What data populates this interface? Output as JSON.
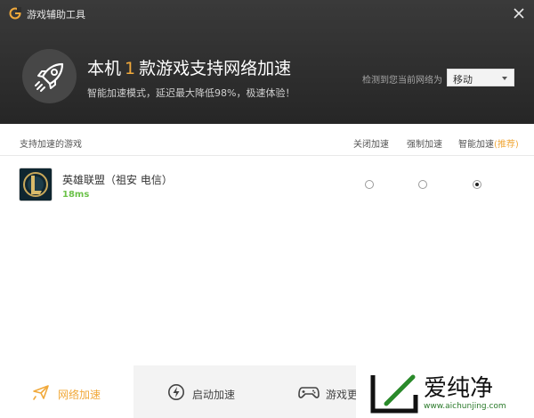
{
  "window": {
    "title": "游戏辅助工具"
  },
  "header": {
    "headline_prefix": "本机",
    "game_count": "1",
    "headline_suffix": "款游戏支持网络加速",
    "subline": "智能加速模式，延迟最大降低98%，极速体验！",
    "network_label": "检测到您当前网络为",
    "network_value": "移动"
  },
  "table": {
    "col_game": "支持加速的游戏",
    "col_off": "关闭加速",
    "col_force": "强制加速",
    "col_smart": "智能加速",
    "col_smart_tag": "(推荐)"
  },
  "games": [
    {
      "name": "英雄联盟（祖安 电信）",
      "ping": "18ms",
      "mode": "smart"
    }
  ],
  "bottom_nav": {
    "items": [
      {
        "label": "网络加速",
        "active": true
      },
      {
        "label": "启动加速",
        "active": false
      },
      {
        "label": "游戏更",
        "active": false
      }
    ]
  },
  "watermark": {
    "text": "爱纯净",
    "url": "www.aichunjing.com"
  },
  "colors": {
    "accent": "#f1a93b",
    "ping": "#6cc24a",
    "header_bg": "#2e2e2e"
  },
  "icons": {
    "app": "app-logo-icon",
    "close": "close-icon",
    "rocket": "rocket-icon",
    "nav_net": "plane-icon",
    "nav_start": "lightning-icon",
    "nav_game": "gamepad-icon"
  }
}
